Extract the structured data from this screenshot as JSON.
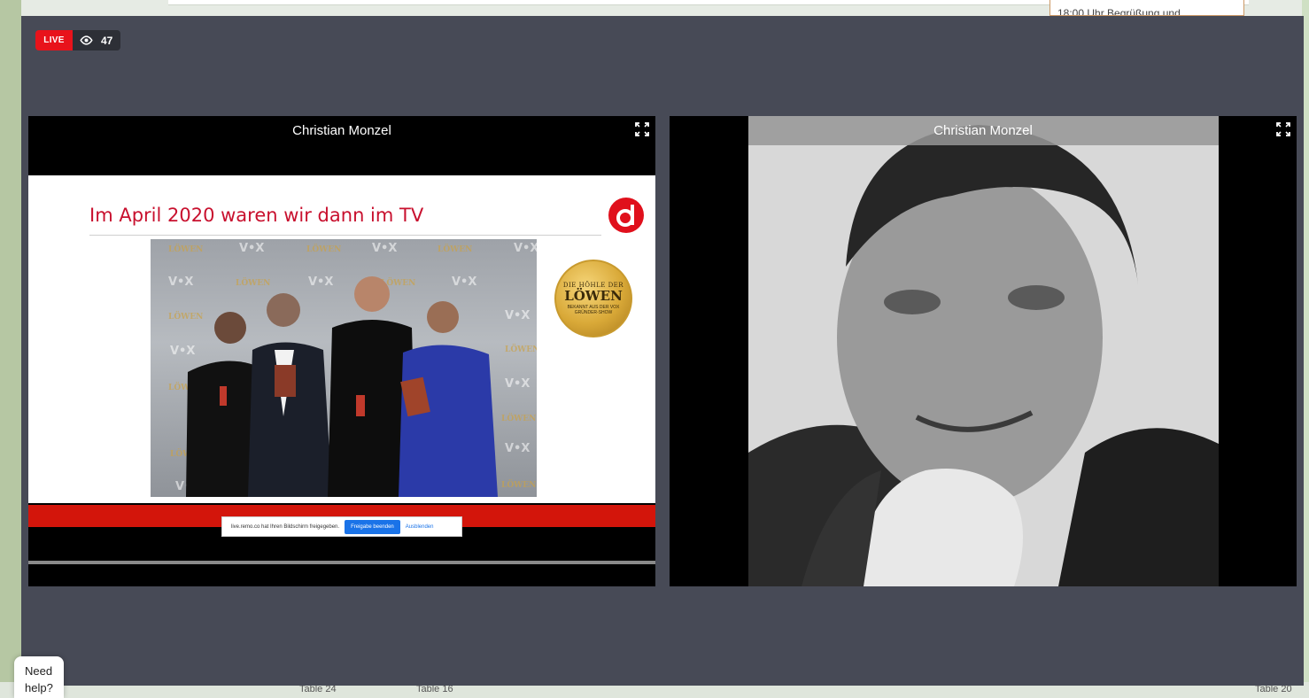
{
  "stream": {
    "live_label": "LIVE",
    "viewer_count": "47"
  },
  "background": {
    "agenda_text": "18:00 Uhr Begrüßung und",
    "tables": [
      "Table 24",
      "Table 16",
      "Table 20"
    ]
  },
  "tiles": [
    {
      "participant_name": "Christian Monzel",
      "content": "screen-share",
      "slide": {
        "title": "Im April 2020 waren wir dann im TV",
        "logo_letter": "d",
        "seal": {
          "line1": "DIE HÖHLE DER",
          "line2": "LÖWEN",
          "line3": "BEKANNT AUS DER VOX GRÜNDER-SHOW"
        }
      },
      "share_notice": {
        "text": "live.remo.co hat Ihren Bildschirm freigegeben.",
        "stop_label": "Freigabe beenden",
        "hide_label": "Ausblenden"
      }
    },
    {
      "participant_name": "Christian Monzel",
      "content": "camera"
    }
  ],
  "help": {
    "label": "Need help?"
  },
  "colors": {
    "live_red": "#e8131b",
    "stage_bg": "#474a56",
    "slide_accent": "#c8102e",
    "share_button": "#1a73e8"
  }
}
